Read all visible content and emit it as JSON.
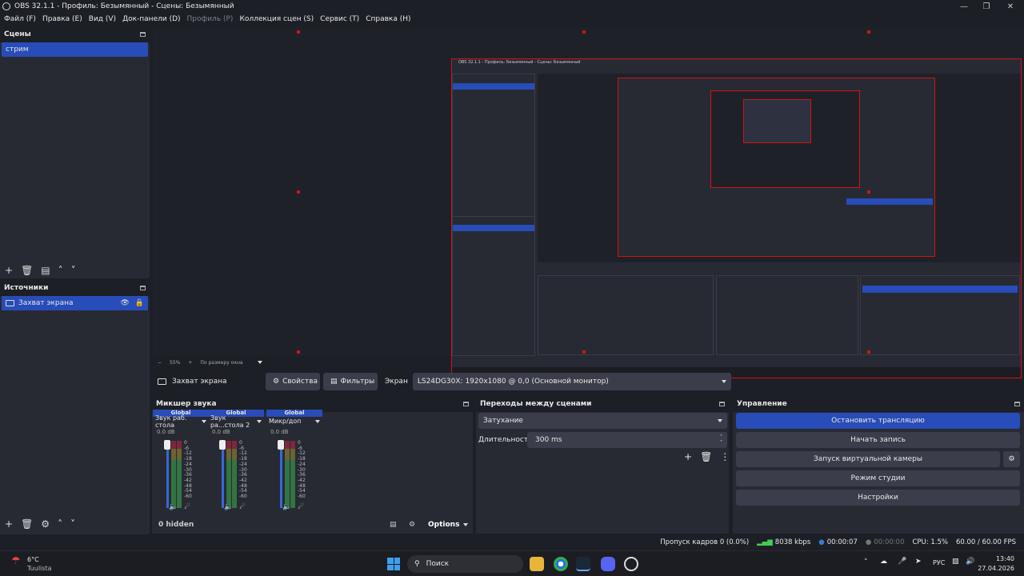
{
  "window": {
    "title": "OBS 32.1.1 - Профиль: Безымянный - Сцены: Безымянный"
  },
  "menu": [
    "Файл (F)",
    "Правка (E)",
    "Вид (V)",
    "Док-панели (D)",
    "Профиль (P)",
    "Коллекция сцен (S)",
    "Сервис (T)",
    "Справка (H)"
  ],
  "menu_disabled_index": 4,
  "scenes": {
    "title": "Сцены",
    "items": [
      "стрим"
    ]
  },
  "sources": {
    "title": "Источники",
    "items": [
      "Захват экрана"
    ]
  },
  "preview": {
    "zoom": "55%",
    "fit": "По размеру окна"
  },
  "source_bar": {
    "name": "Захват экрана",
    "properties": "Свойства",
    "filters": "Фильтры",
    "screen_label": "Экран",
    "screen_value": "LS24DG30X: 1920x1080 @ 0,0 (Основной монитор)"
  },
  "mixer": {
    "title": "Микшер звука",
    "channels": [
      {
        "group": "Global",
        "name": "Звук раб. стола",
        "db": "0.0 dB"
      },
      {
        "group": "Global",
        "name": "Звук ра...стола 2",
        "db": "0.0 dB"
      },
      {
        "group": "Global",
        "name": "Микр/доп",
        "db": "0.0 dB"
      }
    ],
    "scale": [
      "0",
      "-6",
      "-12",
      "-18",
      "-24",
      "-30",
      "-36",
      "-42",
      "-48",
      "-54",
      "-60"
    ],
    "hidden": "0 hidden",
    "options": "Options"
  },
  "transitions": {
    "title": "Переходы между сценами",
    "type": "Затухание",
    "duration_label": "Длительность",
    "duration": "300 ms"
  },
  "controls": {
    "title": "Управление",
    "stop_stream": "Остановить трансляцию",
    "start_record": "Начать запись",
    "virtual_cam": "Запуск виртуальной камеры",
    "studio_mode": "Режим студии",
    "settings": "Настройки",
    "accent": "#284cb8"
  },
  "status": {
    "dropped": "Пропуск кадров 0 (0.0%)",
    "bitrate": "8038 kbps",
    "stream_time": "00:00:07",
    "rec_time": "00:00:00",
    "cpu": "CPU: 1.5%",
    "fps": "60.00 / 60.00 FPS"
  },
  "taskbar": {
    "weather_temp": "6°C",
    "weather_place": "Tuulista",
    "search": "Поиск",
    "lang": "РУС",
    "time": "13:40",
    "date": "27.04.2026"
  },
  "nested": {
    "title": "OBS 32.1.1 - Профиль: Безымянный - Сцены: Безымянный"
  }
}
